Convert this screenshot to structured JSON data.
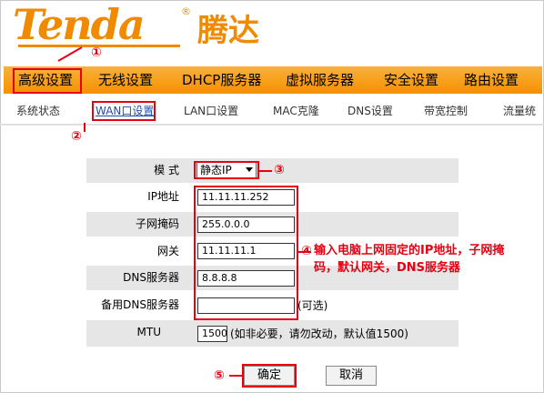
{
  "logo": {
    "word": "Tenda",
    "reg": "®",
    "cn": "腾达"
  },
  "main_nav": [
    "高级设置",
    "无线设置",
    "DHCP服务器",
    "虚拟服务器",
    "安全设置",
    "路由设置"
  ],
  "sub_nav": [
    "系统状态",
    "WAN口设置",
    "LAN口设置",
    "MAC克隆",
    "DNS设置",
    "带宽控制",
    "流量统"
  ],
  "form": {
    "mode_label": "模 式",
    "mode_value": "静态IP",
    "ip_label": "IP地址",
    "ip_value": "11.11.11.252",
    "mask_label": "子网掩码",
    "mask_value": "255.0.0.0",
    "gateway_label": "网关",
    "gateway_value": "11.11.11.1",
    "dns_label": "DNS服务器",
    "dns_value": "8.8.8.8",
    "dns2_label": "备用DNS服务器",
    "dns2_value": "",
    "dns2_hint": "(可选)",
    "mtu_label": "MTU",
    "mtu_value": "1500",
    "mtu_hint": "(如非必要，请勿改动，默认值1500)"
  },
  "buttons": {
    "ok": "确定",
    "cancel": "取消"
  },
  "annotations": {
    "n1": "①",
    "n2": "②",
    "n3": "③",
    "n4": "④",
    "n5": "⑤",
    "note": "输入电脑上网固定的IP地址，子网掩码，默认网关，DNS服务器"
  },
  "colors": {
    "accent_orange": "#f39200",
    "annotation_red": "#e60012",
    "row_shade": "#e6e6e6"
  }
}
